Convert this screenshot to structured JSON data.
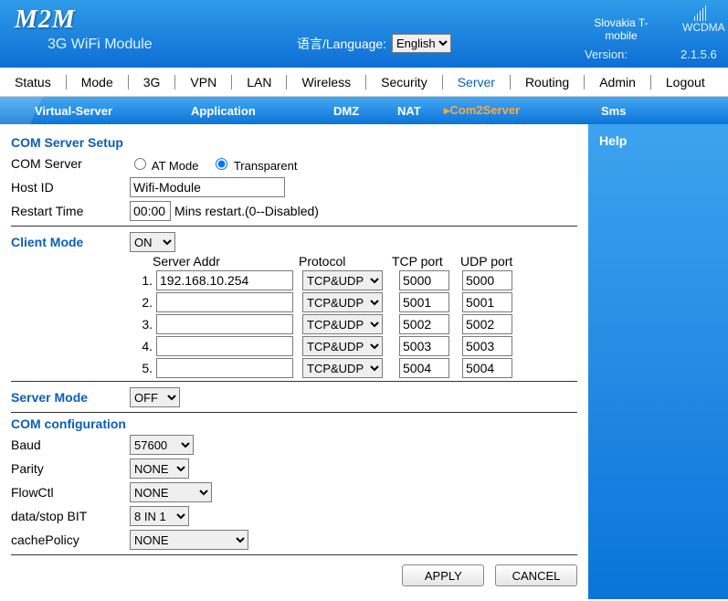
{
  "header": {
    "logo": "M2M",
    "subtitle": "3G WiFi Module",
    "lang_label": "语言/Language:",
    "lang_value": "English",
    "signal_label": "WCDMA",
    "carrier": "Slovakia T-mobile",
    "version_label": "Version:",
    "version_value": "2.1.5.6"
  },
  "mainnav": [
    "Status",
    "Mode",
    "3G",
    "VPN",
    "LAN",
    "Wireless",
    "Security",
    "Server",
    "Routing",
    "Admin",
    "Logout"
  ],
  "mainnav_active": 7,
  "subnav": [
    "Virtual-Server",
    "Application",
    "DMZ",
    "NAT",
    "Com2Server",
    "Sms"
  ],
  "subnav_active": 4,
  "help_title": "Help",
  "sec1": {
    "title": "COM Server Setup",
    "comserver_label": "COM Server",
    "mode_at": "AT Mode",
    "mode_tr": "Transparent",
    "hostid_label": "Host ID",
    "hostid_value": "Wifi-Module",
    "restart_label": "Restart Time",
    "restart_value": "00:00",
    "restart_hint": "Mins restart.(0--Disabled)"
  },
  "client": {
    "title": "Client Mode",
    "value": "ON",
    "cols": {
      "addr": "Server Addr",
      "proto": "Protocol",
      "tcp": "TCP port",
      "udp": "UDP port"
    },
    "rows": [
      {
        "n": "1.",
        "addr": "192.168.10.254",
        "proto": "TCP&UDP",
        "tcp": "5000",
        "udp": "5000"
      },
      {
        "n": "2.",
        "addr": "",
        "proto": "TCP&UDP",
        "tcp": "5001",
        "udp": "5001"
      },
      {
        "n": "3.",
        "addr": "",
        "proto": "TCP&UDP",
        "tcp": "5002",
        "udp": "5002"
      },
      {
        "n": "4.",
        "addr": "",
        "proto": "TCP&UDP",
        "tcp": "5003",
        "udp": "5003"
      },
      {
        "n": "5.",
        "addr": "",
        "proto": "TCP&UDP",
        "tcp": "5004",
        "udp": "5004"
      }
    ]
  },
  "server": {
    "title": "Server Mode",
    "value": "OFF"
  },
  "com": {
    "title": "COM configuration",
    "baud_label": "Baud",
    "baud_value": "57600",
    "parity_label": "Parity",
    "parity_value": "NONE",
    "flow_label": "FlowCtl",
    "flow_value": "NONE",
    "dsb_label": "data/stop BIT",
    "dsb_value": "8 IN 1",
    "cache_label": "cachePolicy",
    "cache_value": "NONE"
  },
  "buttons": {
    "apply": "APPLY",
    "cancel": "CANCEL"
  }
}
